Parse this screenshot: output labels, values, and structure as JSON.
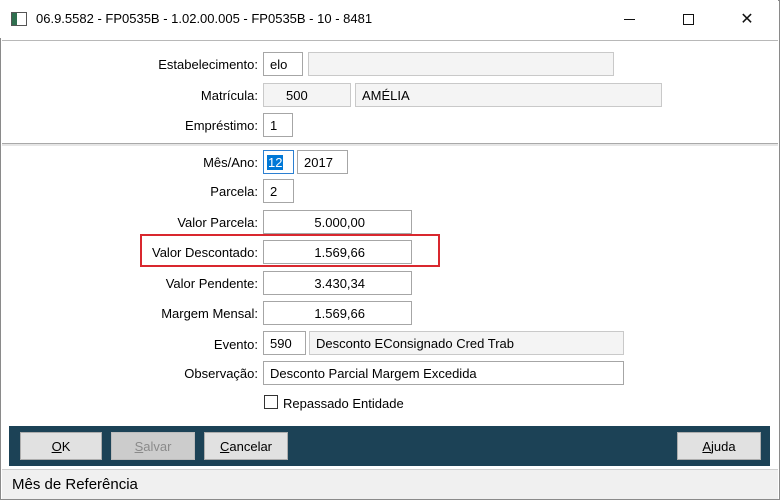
{
  "window": {
    "title": "06.9.5582 - FP0535B - 1.02.00.005 - FP0535B - 10 - 8481"
  },
  "header": {
    "estabelecimento_label": "Estabelecimento:",
    "estabelecimento_code": "elo",
    "estabelecimento_name": "",
    "matricula_label": "Matrícula:",
    "matricula_code": "500",
    "matricula_name": "AMÉLIA",
    "emprestimo_label": "Empréstimo:",
    "emprestimo_value": "1"
  },
  "form": {
    "mes_ano_label": "Mês/Ano:",
    "mes_value": "12",
    "ano_value": "2017",
    "parcela_label": "Parcela:",
    "parcela_value": "2",
    "valor_parcela_label": "Valor Parcela:",
    "valor_parcela_value": "5.000,00",
    "valor_descontado_label": "Valor Descontado:",
    "valor_descontado_value": "1.569,66",
    "valor_pendente_label": "Valor Pendente:",
    "valor_pendente_value": "3.430,34",
    "margem_mensal_label": "Margem Mensal:",
    "margem_mensal_value": "1.569,66",
    "evento_label": "Evento:",
    "evento_code": "590",
    "evento_desc": "Desconto EConsignado Cred Trab",
    "observacao_label": "Observação:",
    "observacao_value": "Desconto Parcial Margem Excedida",
    "repassado_label": "Repassado Entidade",
    "repassado_checked": false
  },
  "buttons": {
    "ok_first": "O",
    "ok_rest": "K",
    "salvar_first": "S",
    "salvar_rest": "alvar",
    "cancelar_first": "C",
    "cancelar_rest": "ancelar",
    "ajuda_first": "A",
    "ajuda_rest": "juda"
  },
  "status": {
    "text": "Mês de Referência"
  },
  "colors": {
    "button_bar": "#1c4256",
    "highlight_border": "#d9272e",
    "selection": "#0078d7"
  }
}
